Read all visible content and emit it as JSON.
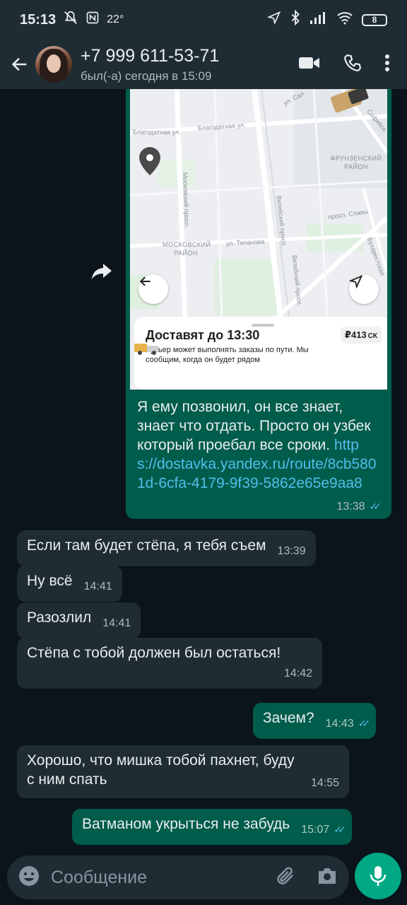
{
  "status_bar": {
    "time": "15:13",
    "temperature": "22°",
    "battery": "8"
  },
  "header": {
    "contact_name": "+7 999 611-53-71",
    "contact_status": "был(-а) сегодня в 15:09"
  },
  "map": {
    "streets": {
      "blagodatnaya_1": "Благодатная ул.",
      "blagodatnaya_2": "Благодатная ул.",
      "moskovsky_prosp": "Московский просп.",
      "vitebsky_1": "Витебский просп.",
      "vitebsky_2": "Витебский просп.",
      "tipanova": "ул. Типанова",
      "slavy": "просп. Славы",
      "bukharestskaya": "Бухарестская",
      "sofiyskaya": "Софийск.",
      "ul_sal": "ул. Сал"
    },
    "districts": {
      "frunzensky": "ФРУНЗЕНСКИЙ РАЙОН",
      "moskovsky": "МОСКОВСКИЙ РАЙОН"
    }
  },
  "delivery_card": {
    "title": "Доставят до 13:30",
    "description": "Курьер может выполнять заказы по пути. Мы сообщим, когда он будет рядом",
    "price": "₽413",
    "price_code": "СК"
  },
  "messages": [
    {
      "direction": "out",
      "text": "Я ему позвонил, он все знает, знает что отдать. Просто он узбек который проебал все сроки.",
      "link": "https://dostavka.yandex.ru/route/8cb5801d-6cfa-4179-9f39-5862e65e9aa8",
      "time": "13:38",
      "read": true
    },
    {
      "direction": "in",
      "text": "Если там будет стёпа, я тебя съем",
      "time": "13:39"
    },
    {
      "direction": "in",
      "text": "Ну всё",
      "time": "14:41"
    },
    {
      "direction": "in",
      "text": "Разозлил",
      "time": "14:41"
    },
    {
      "direction": "in",
      "text": "Стёпа с тобой должен был остаться!",
      "time": "14:42"
    },
    {
      "direction": "out",
      "text": "Зачем?",
      "time": "14:43",
      "read": true
    },
    {
      "direction": "in",
      "text": "Хорошо, что мишка тобой пахнет, буду с ним спать",
      "time": "14:55"
    },
    {
      "direction": "out",
      "text": "Ватманом укрыться не забудь",
      "time": "15:07",
      "read": true
    }
  ],
  "input": {
    "placeholder": "Сообщение"
  },
  "colors": {
    "background": "#0b141a",
    "header": "#1f2c34",
    "incoming_bubble": "#202c33",
    "outgoing_bubble": "#005c4b",
    "link": "#53bdeb",
    "mic_button": "#00a884"
  }
}
